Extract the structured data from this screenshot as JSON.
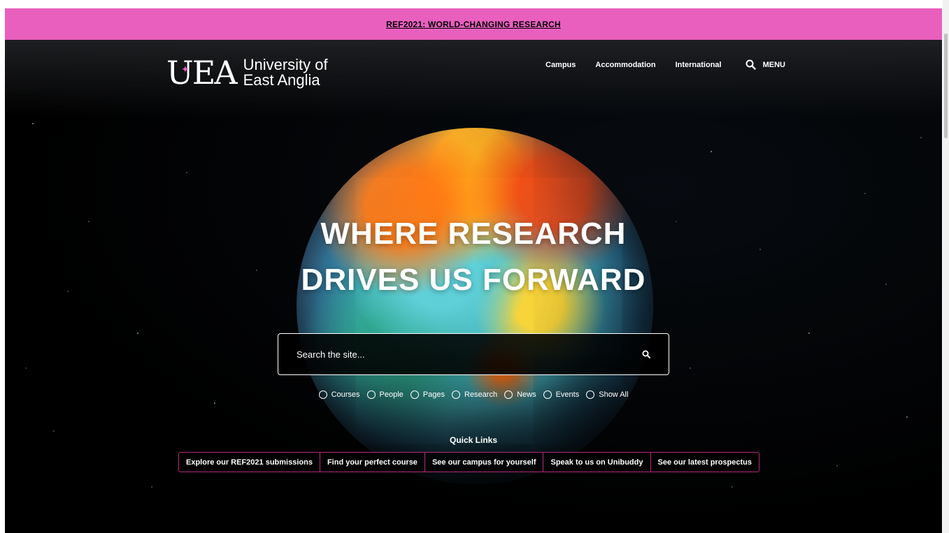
{
  "banner": {
    "label": "REF2021: WORLD-CHANGING RESEARCH"
  },
  "header": {
    "logo_mark": "UEA",
    "logo_line1": "University of",
    "logo_line2": "East Anglia",
    "nav": [
      "Campus",
      "Accommodation",
      "International"
    ],
    "menu_label": "MENU"
  },
  "hero": {
    "headline_line1": "WHERE RESEARCH",
    "headline_line2": "DRIVES US FORWARD"
  },
  "search": {
    "placeholder": "Search the site...",
    "filters": [
      "Courses",
      "People",
      "Pages",
      "Research",
      "News",
      "Events",
      "Show All"
    ]
  },
  "quick_links": {
    "title": "Quick Links",
    "items": [
      "Explore our REF2021 submissions",
      "Find your perfect course",
      "See our campus for yourself",
      "Speak to us on Unibuddy",
      "See our latest prospectus"
    ]
  },
  "colors": {
    "accent": "#e95fbe",
    "border": "#b02c7c"
  }
}
